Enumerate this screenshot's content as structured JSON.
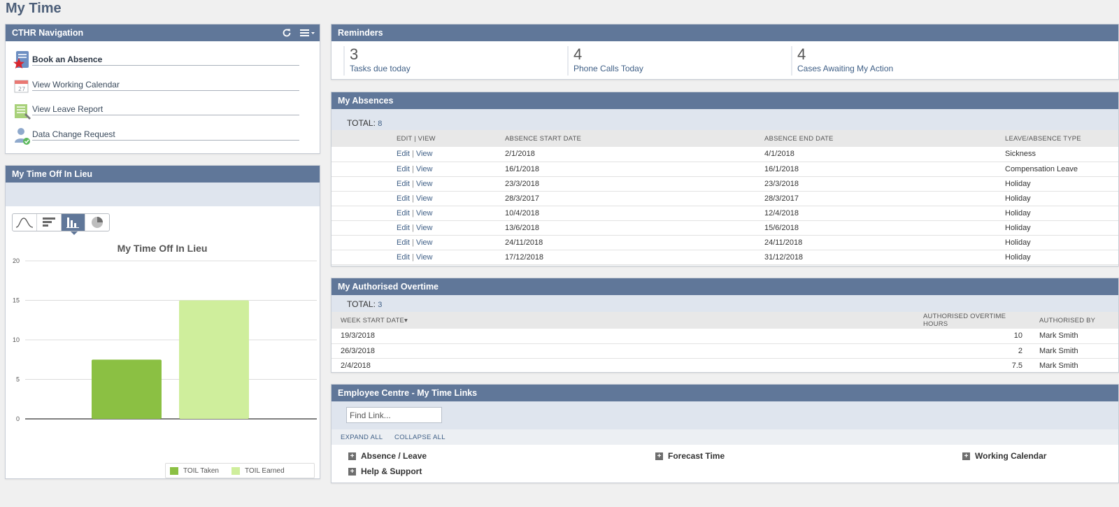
{
  "page_title": "My Time",
  "navigation": {
    "title": "CTHR Navigation",
    "items": [
      {
        "label": "Book an Absence"
      },
      {
        "label": "View Working Calendar"
      },
      {
        "label": "View Leave Report"
      },
      {
        "label": "Data Change Request"
      }
    ]
  },
  "reminders": {
    "title": "Reminders",
    "items": [
      {
        "count": "3",
        "label": "Tasks due today"
      },
      {
        "count": "4",
        "label": "Phone Calls Today"
      },
      {
        "count": "4",
        "label": "Cases Awaiting My Action"
      }
    ]
  },
  "absences": {
    "title": "My Absences",
    "total_label": "TOTAL:",
    "total": "8",
    "columns": [
      "EDIT | VIEW",
      "ABSENCE START DATE",
      "ABSENCE END DATE",
      "LEAVE/ABSENCE TYPE"
    ],
    "edit_label": "Edit",
    "view_label": "View",
    "rows": [
      {
        "start": "2/1/2018",
        "end": "4/1/2018",
        "type": "Sickness"
      },
      {
        "start": "16/1/2018",
        "end": "16/1/2018",
        "type": "Compensation Leave"
      },
      {
        "start": "23/3/2018",
        "end": "23/3/2018",
        "type": "Holiday"
      },
      {
        "start": "28/3/2017",
        "end": "28/3/2017",
        "type": "Holiday"
      },
      {
        "start": "10/4/2018",
        "end": "12/4/2018",
        "type": "Holiday"
      },
      {
        "start": "13/6/2018",
        "end": "15/6/2018",
        "type": "Holiday"
      },
      {
        "start": "24/11/2018",
        "end": "24/11/2018",
        "type": "Holiday"
      },
      {
        "start": "17/12/2018",
        "end": "31/12/2018",
        "type": "Holiday"
      }
    ]
  },
  "overtime": {
    "title": "My Authorised Overtime",
    "total_label": "TOTAL:",
    "total": "3",
    "columns": [
      "WEEK START DATE",
      "AUTHORISED OVERTIME HOURS",
      "AUTHORISED BY"
    ],
    "sort_indicator": "▾",
    "rows": [
      {
        "week": "19/3/2018",
        "hours": "10",
        "by": "Mark Smith"
      },
      {
        "week": "26/3/2018",
        "hours": "2",
        "by": "Mark Smith"
      },
      {
        "week": "2/4/2018",
        "hours": "7.5",
        "by": "Mark Smith"
      }
    ]
  },
  "links": {
    "title": "Employee Centre - My Time Links",
    "find_placeholder": "Find Link...",
    "expand_all": "EXPAND ALL",
    "collapse_all": "COLLAPSE ALL",
    "categories": [
      "Absence / Leave",
      "Forecast Time",
      "Working Calendar",
      "Help & Support"
    ]
  },
  "toil": {
    "title": "My Time Off In Lieu"
  },
  "colors": {
    "header": "#607799",
    "link": "#3f5f86",
    "toil_taken": "#8bc043",
    "toil_earned": "#cfee9c"
  },
  "chart_data": {
    "type": "bar",
    "title": "My Time Off In Lieu",
    "categories": [
      "TOIL Taken",
      "TOIL Earned"
    ],
    "values": [
      7.5,
      15
    ],
    "ylim": [
      0,
      20
    ],
    "yticks": [
      0,
      5,
      10,
      15,
      20
    ],
    "grid": true,
    "legend": "bottom-right",
    "series": [
      {
        "name": "TOIL Taken",
        "values": [
          7.5
        ],
        "color": "#8bc043"
      },
      {
        "name": "TOIL Earned",
        "values": [
          15
        ],
        "color": "#cfee9c"
      }
    ]
  }
}
